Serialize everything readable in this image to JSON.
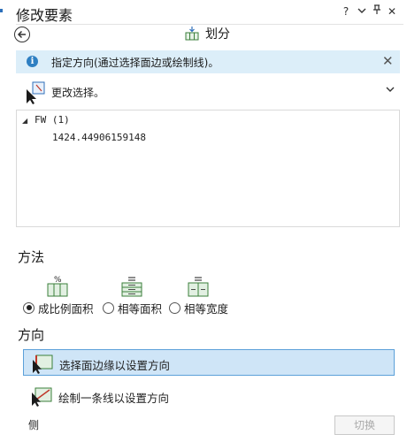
{
  "pane": {
    "title": "修改要素",
    "help": "?",
    "menu": "⌄",
    "pin": "ᵩ",
    "close": "✕"
  },
  "tool": {
    "title": "划分"
  },
  "info": {
    "text": "指定方向(通过选择面边或绘制线)。",
    "close": "✕"
  },
  "selection": {
    "label": "更改选择。",
    "chevron": "⌄"
  },
  "features": {
    "layer": "FW (1)",
    "items": [
      "1424.44906159148"
    ]
  },
  "method": {
    "heading": "方法",
    "options": [
      {
        "label": "成比例面积",
        "selected": true,
        "icon": "proportional-area-icon"
      },
      {
        "label": "相等面积",
        "selected": false,
        "icon": "equal-area-icon"
      },
      {
        "label": "相等宽度",
        "selected": false,
        "icon": "equal-width-icon"
      }
    ]
  },
  "direction": {
    "heading": "方向",
    "options": [
      {
        "label": "选择面边缘以设置方向",
        "selected": true,
        "icon": "select-edge-icon"
      },
      {
        "label": "绘制一条线以设置方向",
        "selected": false,
        "icon": "draw-line-icon"
      }
    ]
  },
  "footer": {
    "side_label": "侧",
    "switch_label": "切换"
  },
  "colors": {
    "accent": "#2c6fba",
    "info_bg": "#dceef9",
    "selected_bg": "#cfe5f7",
    "icon_green": "#2f8a3e"
  }
}
